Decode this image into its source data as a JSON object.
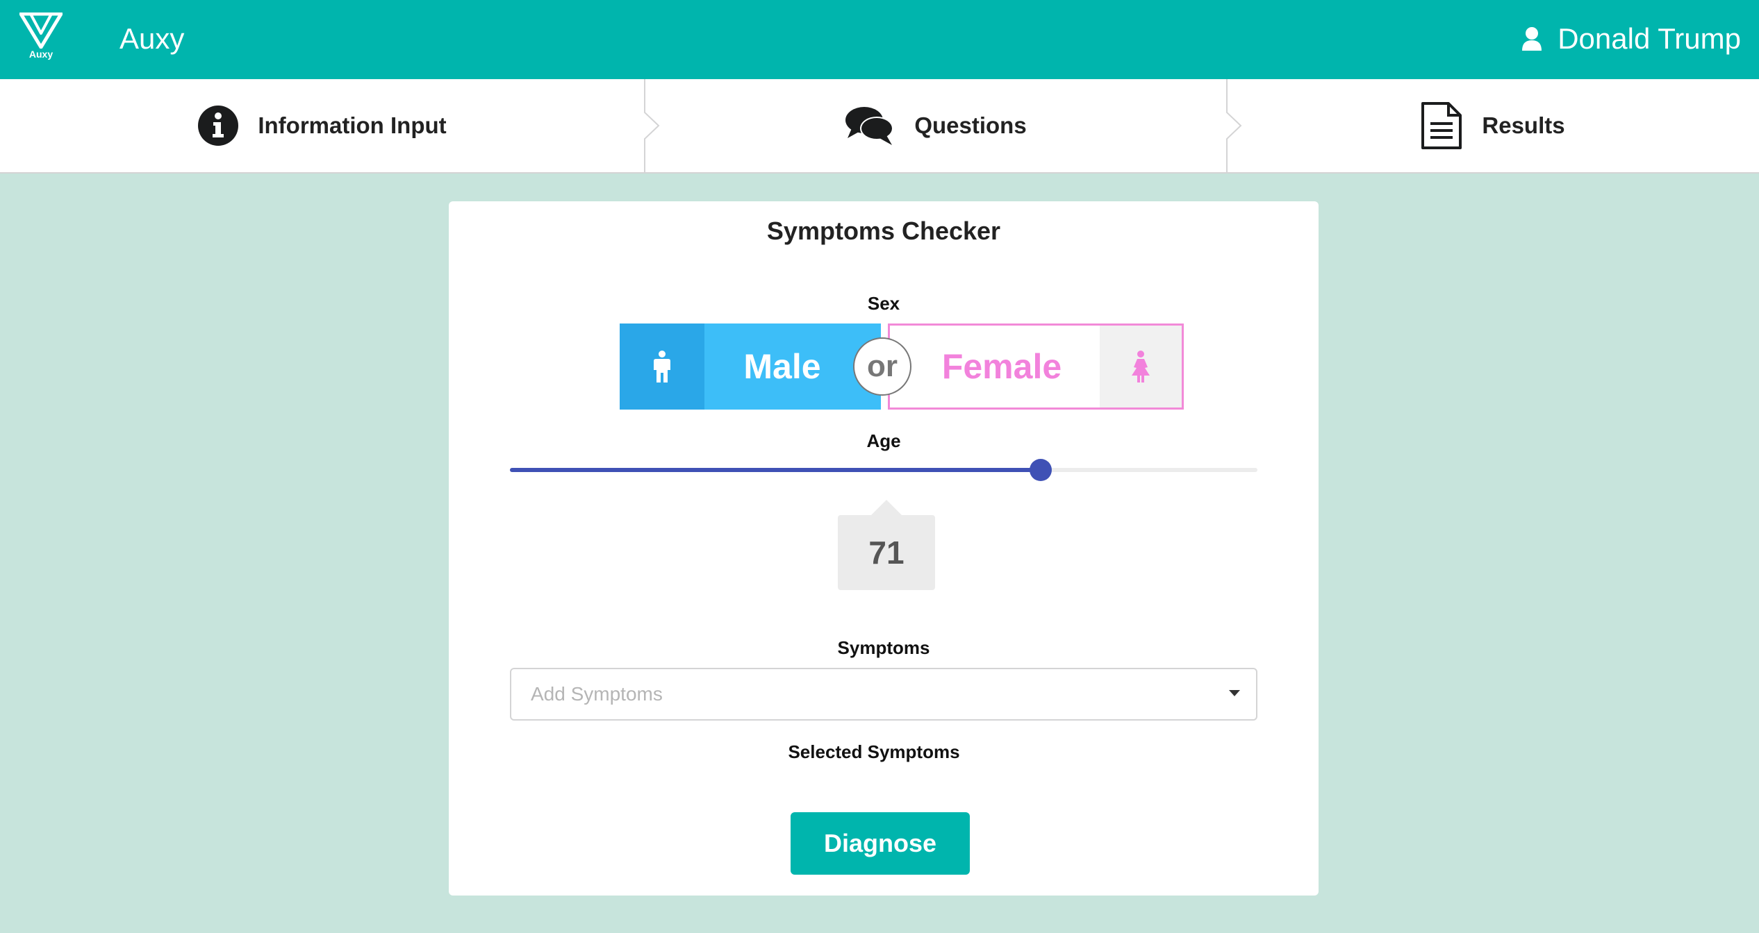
{
  "header": {
    "logo_text": "Auxy",
    "app_name": "Auxy",
    "user_icon": "user-icon",
    "user_name": "Donald Trump",
    "background_color": "#00b5ad"
  },
  "steps": [
    {
      "label": "Information Input",
      "icon": "info-circle-icon"
    },
    {
      "label": "Questions",
      "icon": "comments-icon"
    },
    {
      "label": "Results",
      "icon": "document-icon"
    }
  ],
  "card": {
    "title": "Symptoms Checker",
    "sex": {
      "label": "Sex",
      "male_label": "Male",
      "or_label": "or",
      "female_label": "Female",
      "selected": "Male",
      "male_color": "#3dbef8",
      "female_color": "#f282dc"
    },
    "age": {
      "label": "Age",
      "value": "71",
      "min": 0,
      "max": 100,
      "fill_color": "#3f51b5"
    },
    "symptoms": {
      "label": "Symptoms",
      "placeholder": "Add Symptoms",
      "value": ""
    },
    "selected_symptoms_label": "Selected Symptoms",
    "diagnose_label": "Diagnose"
  }
}
